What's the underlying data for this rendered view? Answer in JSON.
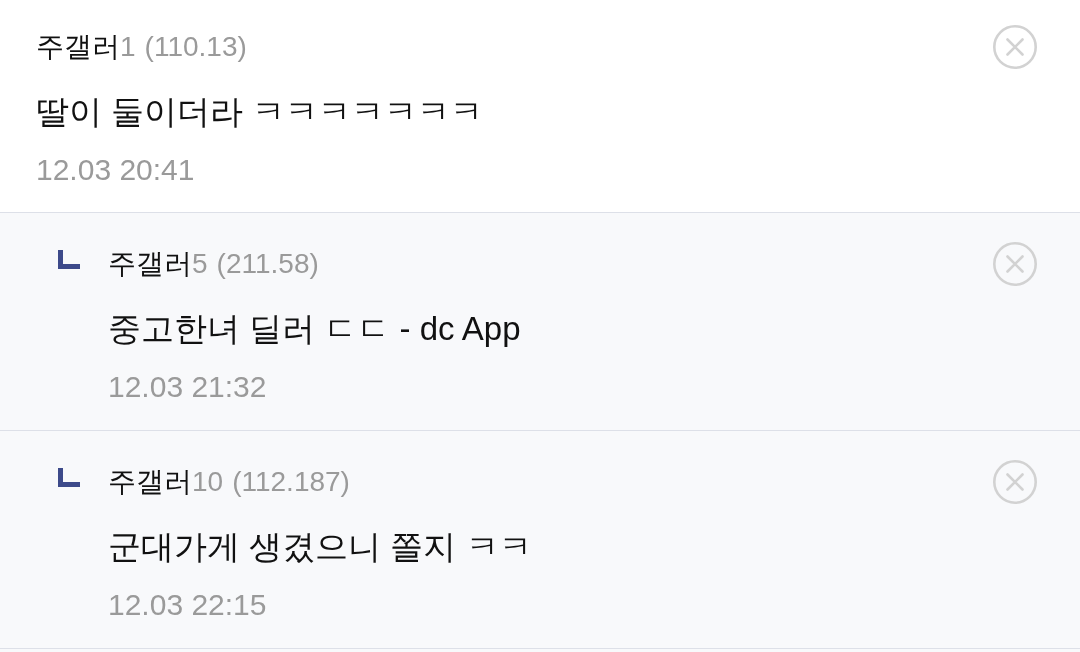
{
  "comments": [
    {
      "author": "주갤러",
      "author_number": "1",
      "ip": "(110.13)",
      "text": "딸이 둘이더라 ㅋㅋㅋㅋㅋㅋㅋ",
      "time": "12.03 20:41",
      "replies": [
        {
          "author": "주갤러",
          "author_number": "5",
          "ip": "(211.58)",
          "text": "중고한녀 딜러 ㄷㄷ - dc App",
          "time": "12.03 21:32"
        },
        {
          "author": "주갤러",
          "author_number": "10",
          "ip": "(112.187)",
          "text": "군대가게 생겼으니 쫄지 ㅋㅋ",
          "time": "12.03 22:15"
        }
      ]
    }
  ]
}
